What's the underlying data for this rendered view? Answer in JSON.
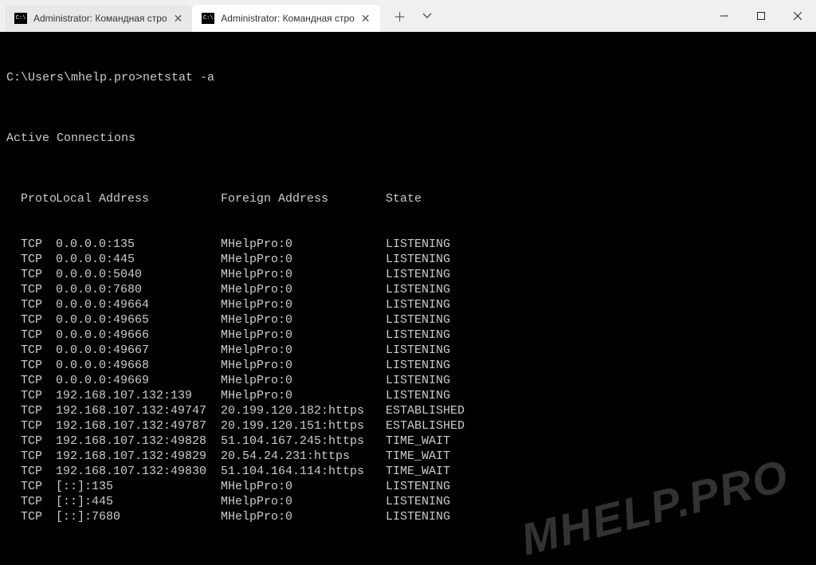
{
  "tabs": [
    {
      "label": "Administrator: Командная стро",
      "active": false
    },
    {
      "label": "Administrator: Командная стро",
      "active": true
    }
  ],
  "prompt": {
    "path": "C:\\Users\\mhelp.pro>",
    "command": "netstat -a"
  },
  "section_title": "Active Connections",
  "headers": {
    "proto": "Proto",
    "local": "Local Address",
    "foreign": "Foreign Address",
    "state": "State"
  },
  "rows": [
    {
      "proto": "TCP",
      "local": "0.0.0.0:135",
      "foreign": "MHelpPro:0",
      "state": "LISTENING"
    },
    {
      "proto": "TCP",
      "local": "0.0.0.0:445",
      "foreign": "MHelpPro:0",
      "state": "LISTENING"
    },
    {
      "proto": "TCP",
      "local": "0.0.0.0:5040",
      "foreign": "MHelpPro:0",
      "state": "LISTENING"
    },
    {
      "proto": "TCP",
      "local": "0.0.0.0:7680",
      "foreign": "MHelpPro:0",
      "state": "LISTENING"
    },
    {
      "proto": "TCP",
      "local": "0.0.0.0:49664",
      "foreign": "MHelpPro:0",
      "state": "LISTENING"
    },
    {
      "proto": "TCP",
      "local": "0.0.0.0:49665",
      "foreign": "MHelpPro:0",
      "state": "LISTENING"
    },
    {
      "proto": "TCP",
      "local": "0.0.0.0:49666",
      "foreign": "MHelpPro:0",
      "state": "LISTENING"
    },
    {
      "proto": "TCP",
      "local": "0.0.0.0:49667",
      "foreign": "MHelpPro:0",
      "state": "LISTENING"
    },
    {
      "proto": "TCP",
      "local": "0.0.0.0:49668",
      "foreign": "MHelpPro:0",
      "state": "LISTENING"
    },
    {
      "proto": "TCP",
      "local": "0.0.0.0:49669",
      "foreign": "MHelpPro:0",
      "state": "LISTENING"
    },
    {
      "proto": "TCP",
      "local": "192.168.107.132:139",
      "foreign": "MHelpPro:0",
      "state": "LISTENING"
    },
    {
      "proto": "TCP",
      "local": "192.168.107.132:49747",
      "foreign": "20.199.120.182:https",
      "state": "ESTABLISHED"
    },
    {
      "proto": "TCP",
      "local": "192.168.107.132:49787",
      "foreign": "20.199.120.151:https",
      "state": "ESTABLISHED"
    },
    {
      "proto": "TCP",
      "local": "192.168.107.132:49828",
      "foreign": "51.104.167.245:https",
      "state": "TIME_WAIT"
    },
    {
      "proto": "TCP",
      "local": "192.168.107.132:49829",
      "foreign": "20.54.24.231:https",
      "state": "TIME_WAIT"
    },
    {
      "proto": "TCP",
      "local": "192.168.107.132:49830",
      "foreign": "51.104.164.114:https",
      "state": "TIME_WAIT"
    },
    {
      "proto": "TCP",
      "local": "[::]:135",
      "foreign": "MHelpPro:0",
      "state": "LISTENING"
    },
    {
      "proto": "TCP",
      "local": "[::]:445",
      "foreign": "MHelpPro:0",
      "state": "LISTENING"
    },
    {
      "proto": "TCP",
      "local": "[::]:7680",
      "foreign": "MHelpPro:0",
      "state": "LISTENING"
    }
  ],
  "watermark": "MHELP.PRO"
}
